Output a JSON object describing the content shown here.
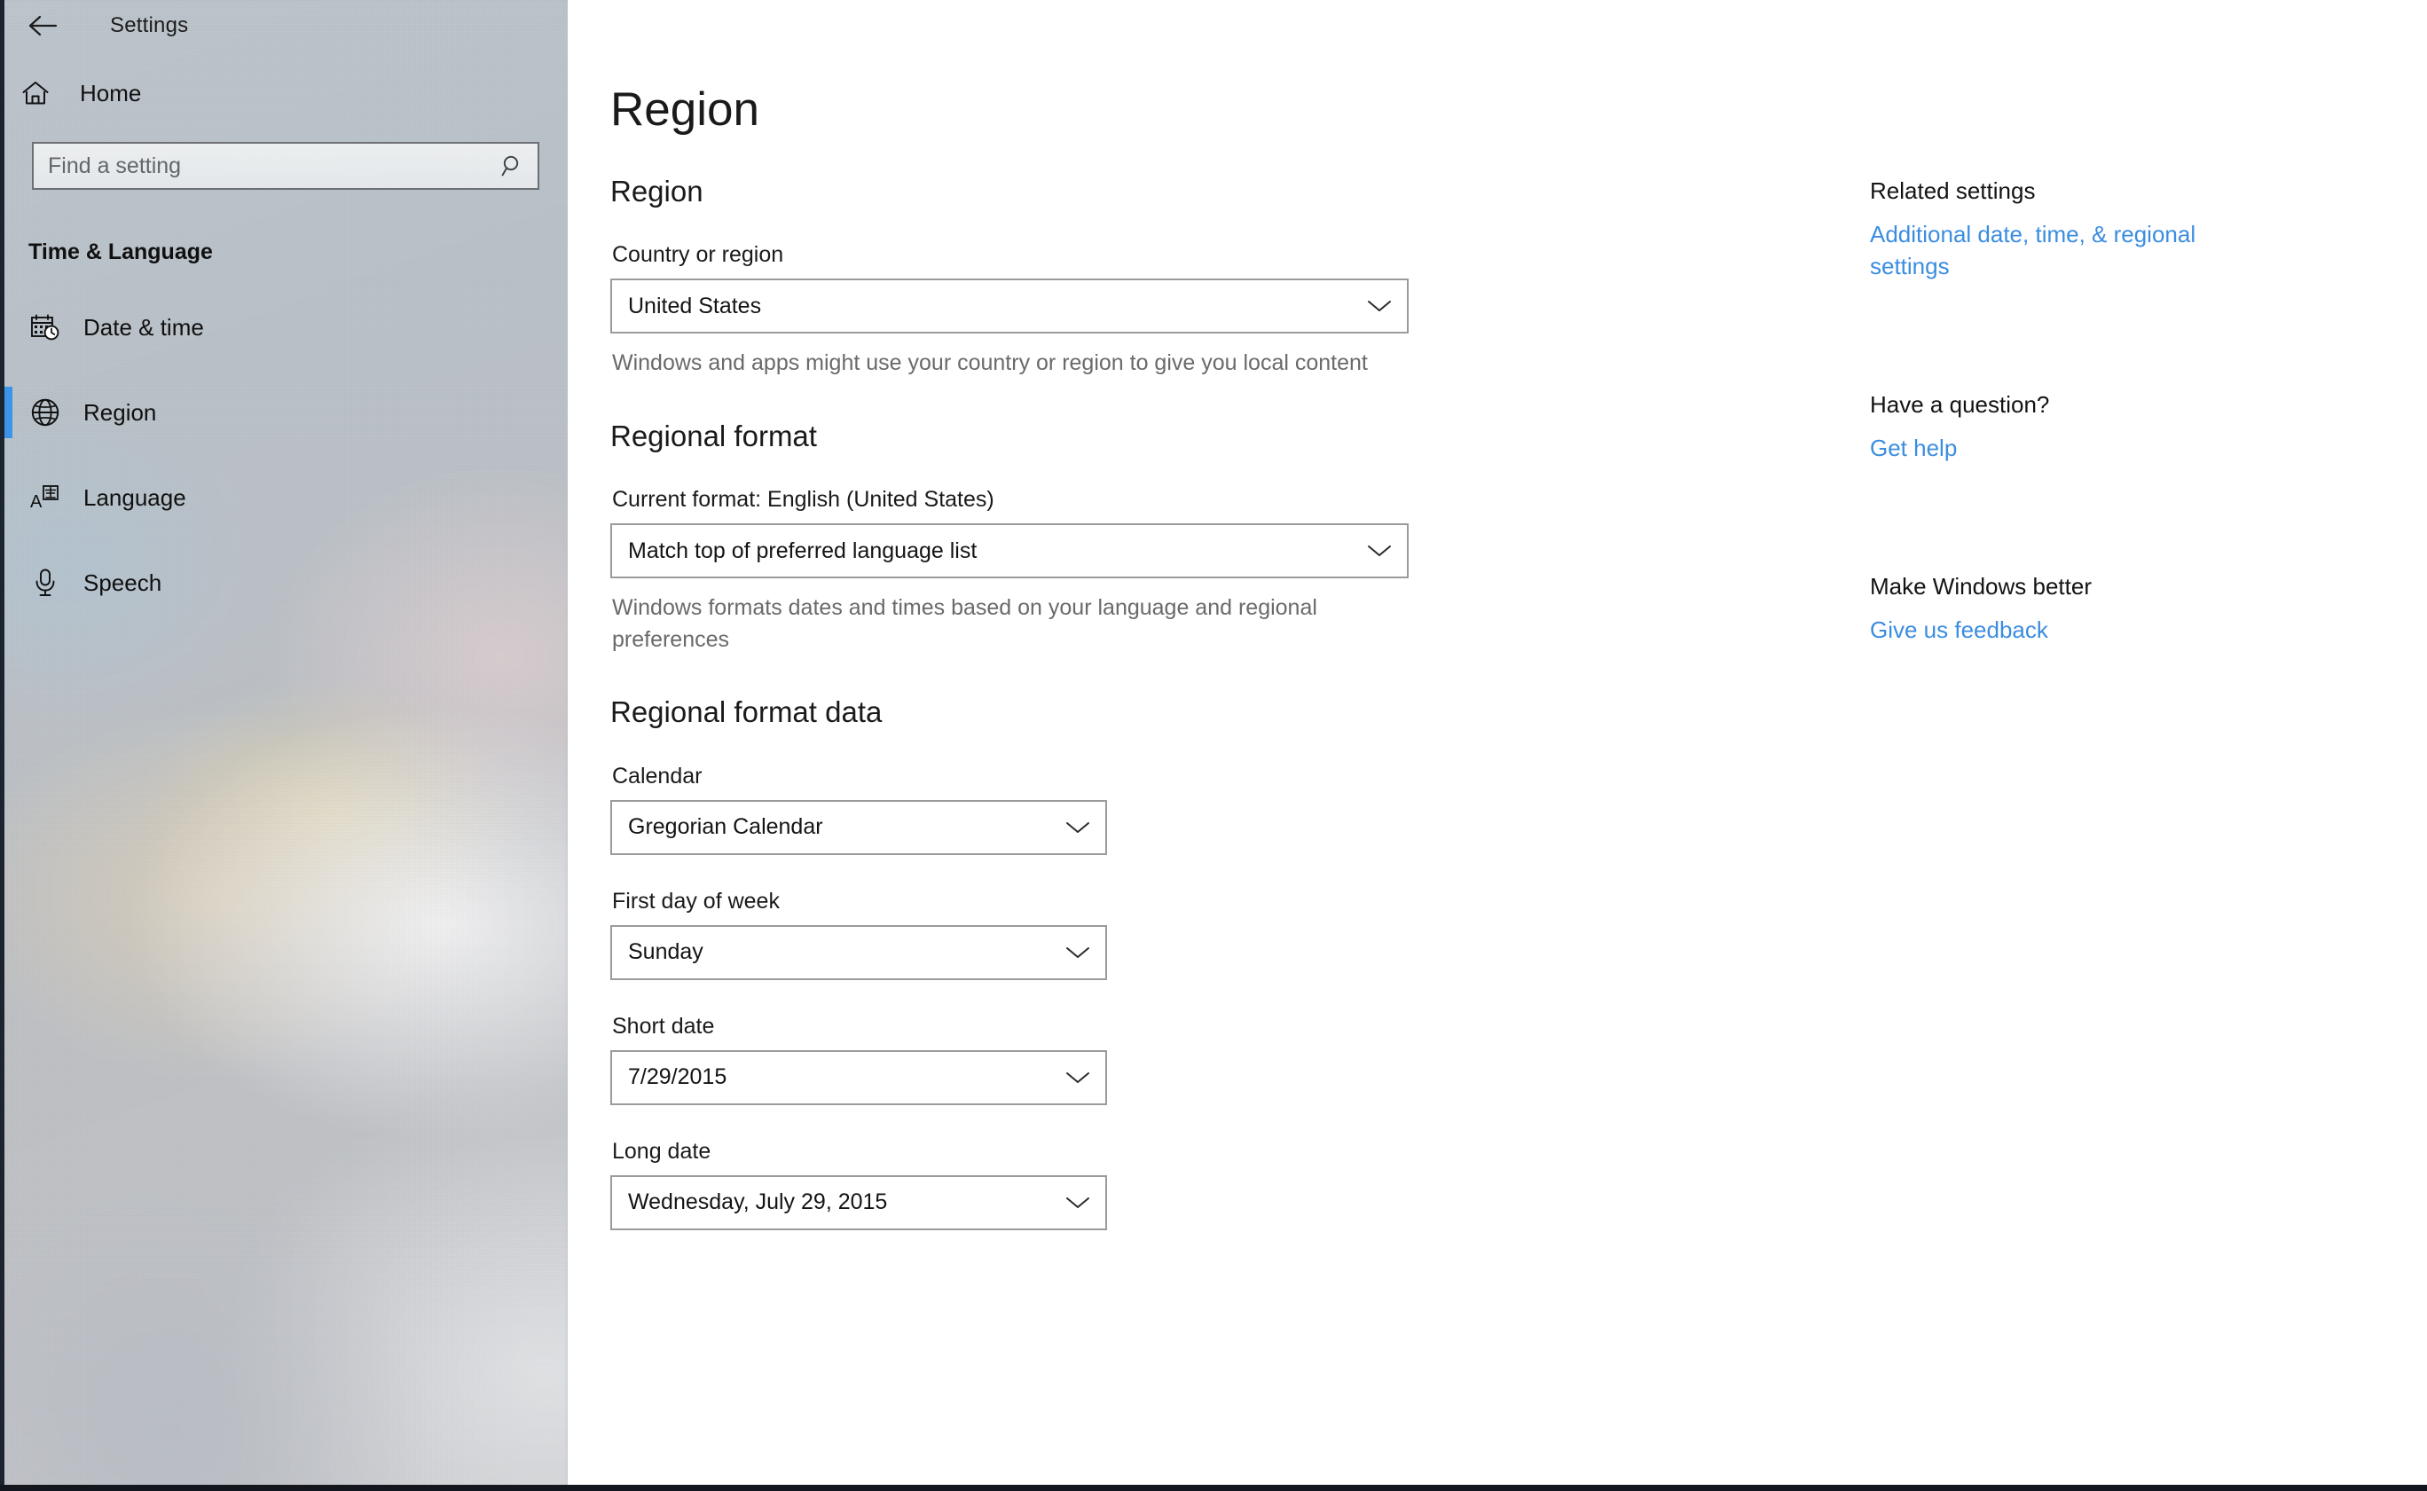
{
  "window": {
    "app_title": "Settings",
    "back_icon": "back-arrow-icon"
  },
  "sidebar": {
    "home": {
      "label": "Home",
      "icon": "home-icon"
    },
    "search": {
      "placeholder": "Find a setting",
      "value": "",
      "icon": "search-icon"
    },
    "group_header": "Time & Language",
    "items": [
      {
        "label": "Date & time",
        "icon": "calendar-clock-icon",
        "selected": false
      },
      {
        "label": "Region",
        "icon": "globe-icon",
        "selected": true
      },
      {
        "label": "Language",
        "icon": "language-icon",
        "selected": false
      },
      {
        "label": "Speech",
        "icon": "microphone-icon",
        "selected": false
      }
    ],
    "accent_color": "#3b94e8"
  },
  "main": {
    "page_title": "Region",
    "sections": {
      "region": {
        "heading": "Region",
        "country_label": "Country or region",
        "country_value": "United States",
        "country_helper": "Windows and apps might use your country or region to give you local content"
      },
      "regional_format": {
        "heading": "Regional format",
        "current_format_label": "Current format: English (United States)",
        "format_value": "Match top of preferred language list",
        "format_helper": "Windows formats dates and times based on your language and regional preferences"
      },
      "regional_format_data": {
        "heading": "Regional format data",
        "fields": [
          {
            "label": "Calendar",
            "value": "Gregorian Calendar"
          },
          {
            "label": "First day of week",
            "value": "Sunday"
          },
          {
            "label": "Short date",
            "value": "7/29/2015"
          },
          {
            "label": "Long date",
            "value": "Wednesday, July 29, 2015"
          }
        ]
      }
    }
  },
  "rail": {
    "related_heading": "Related settings",
    "related_link": "Additional date, time, & regional settings",
    "question_heading": "Have a question?",
    "question_link": "Get help",
    "feedback_heading": "Make Windows better",
    "feedback_link": "Give us feedback",
    "link_color": "#3b8de0"
  }
}
